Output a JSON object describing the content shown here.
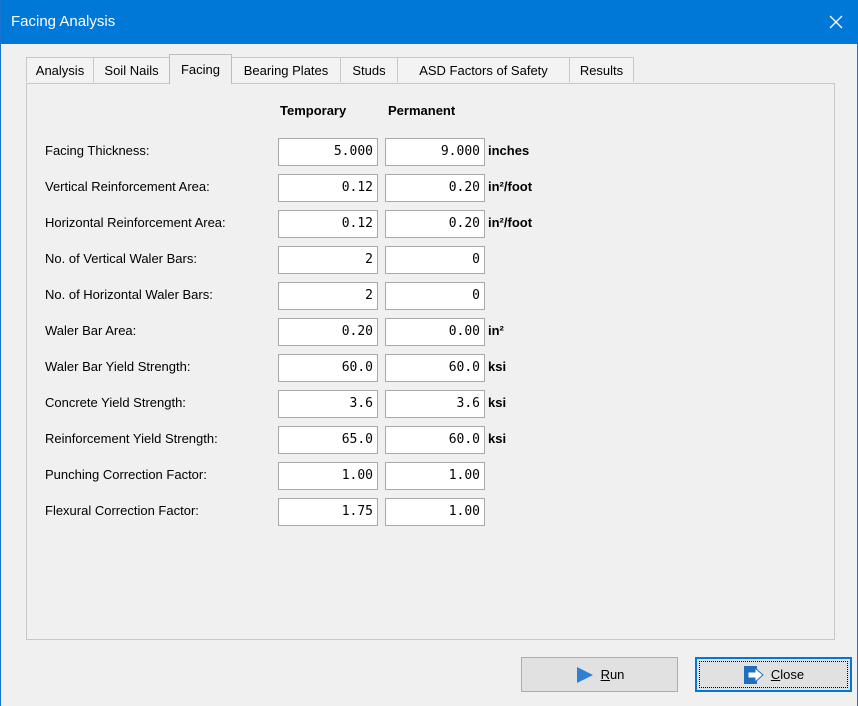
{
  "window": {
    "title": "Facing Analysis"
  },
  "tabs": [
    {
      "label": "Analysis"
    },
    {
      "label": "Soil Nails"
    },
    {
      "label": "Facing"
    },
    {
      "label": "Bearing Plates"
    },
    {
      "label": "Studs"
    },
    {
      "label": "ASD Factors of Safety"
    },
    {
      "label": "Results"
    }
  ],
  "active_tab": "Facing",
  "columns": {
    "temporary": "Temporary",
    "permanent": "Permanent"
  },
  "rows": [
    {
      "label": "Facing Thickness:",
      "temporary": "5.000",
      "permanent": "9.000",
      "unit": "inches"
    },
    {
      "label": "Vertical Reinforcement Area:",
      "temporary": "0.12",
      "permanent": "0.20",
      "unit": "in²/foot"
    },
    {
      "label": "Horizontal Reinforcement Area:",
      "temporary": "0.12",
      "permanent": "0.20",
      "unit": "in²/foot"
    },
    {
      "label": "No. of Vertical Waler Bars:",
      "temporary": "2",
      "permanent": "0",
      "unit": ""
    },
    {
      "label": "No. of Horizontal Waler Bars:",
      "temporary": "2",
      "permanent": "0",
      "unit": ""
    },
    {
      "label": "Waler Bar Area:",
      "temporary": "0.20",
      "permanent": "0.00",
      "unit": "in²"
    },
    {
      "label": "Waler Bar Yield Strength:",
      "temporary": "60.0",
      "permanent": "60.0",
      "unit": "ksi"
    },
    {
      "label": "Concrete Yield Strength:",
      "temporary": "3.6",
      "permanent": "3.6",
      "unit": "ksi"
    },
    {
      "label": "Reinforcement Yield Strength:",
      "temporary": "65.0",
      "permanent": "60.0",
      "unit": "ksi"
    },
    {
      "label": "Punching Correction Factor:",
      "temporary": "1.00",
      "permanent": "1.00",
      "unit": ""
    },
    {
      "label": "Flexural Correction Factor:",
      "temporary": "1.75",
      "permanent": "1.00",
      "unit": ""
    }
  ],
  "buttons": {
    "run": {
      "label_prefix": "",
      "label_mnemonic": "R",
      "label_rest": "un",
      "icon": "play-arrow-icon"
    },
    "close": {
      "label_prefix": "",
      "label_mnemonic": "C",
      "label_rest": "lose",
      "icon": "exit-door-icon"
    }
  },
  "colors": {
    "titlebar": "#0078d7",
    "window_bg": "#f0f0f0",
    "run_icon": "#2f7fd3",
    "close_icon": "#1f6fc0"
  }
}
